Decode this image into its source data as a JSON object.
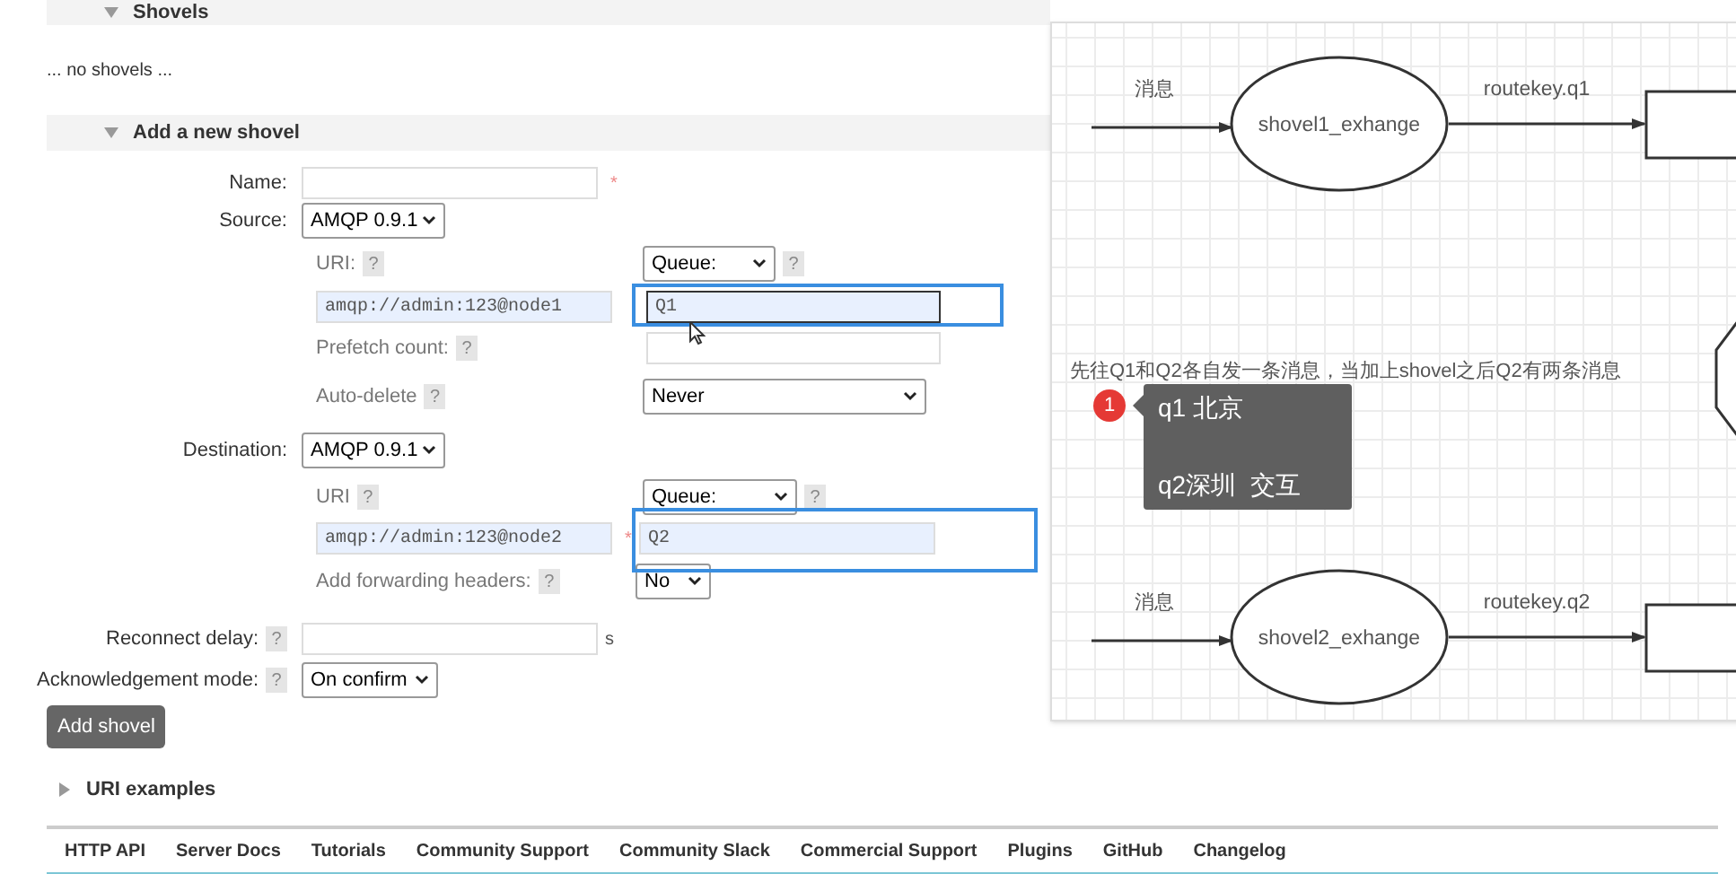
{
  "shovels_section": {
    "title": "Shovels",
    "expanded": true,
    "empty_text": "... no shovels ..."
  },
  "add_section": {
    "title": "Add a new shovel",
    "expanded": true
  },
  "form": {
    "name": {
      "label": "Name:",
      "required_mark": "*"
    },
    "source": {
      "label": "Source:",
      "protocol": "AMQP 0.9.1",
      "uri_label": "URI:",
      "uri_help": "?",
      "uri": "amqp://admin:123@node1",
      "type": "Queue:",
      "type_help": "?",
      "queue": "Q1",
      "queue_focused": true,
      "prefetch_label": "Prefetch count:",
      "prefetch_help": "?",
      "auto_delete_label": "Auto-delete",
      "auto_delete_help": "?",
      "auto_delete": "Never"
    },
    "destination": {
      "label": "Destination:",
      "protocol": "AMQP 0.9.1",
      "uri_label": "URI",
      "uri_help": "?",
      "uri": "amqp://admin:123@node2",
      "required_mark": "*",
      "type": "Queue:",
      "type_help": "?",
      "queue": "Q2",
      "queue_focused": false,
      "headers_label": "Add forwarding headers:",
      "headers_help": "?",
      "headers": "No"
    },
    "reconnect": {
      "label": "Reconnect delay:",
      "help": "?",
      "unit": "s"
    },
    "ack": {
      "label": "Acknowledgement mode:",
      "help": "?",
      "value": "On confirm"
    },
    "submit": "Add shovel"
  },
  "uri_examples": {
    "title": "URI examples",
    "expanded": false
  },
  "footer_links": [
    "HTTP API",
    "Server Docs",
    "Tutorials",
    "Community Support",
    "Community Slack",
    "Commercial Support",
    "Plugins",
    "GitHub",
    "Changelog"
  ],
  "diagram": {
    "flows": [
      {
        "input_label": "消息",
        "exchange": "shovel1_exhange",
        "route_label": "routekey.q1"
      },
      {
        "input_label": "消息",
        "exchange": "shovel2_exhange",
        "route_label": "routekey.q2"
      }
    ],
    "note": "先往Q1和Q2各自发一条消息，当加上shovel之后Q2有两条消息"
  },
  "tooltip": {
    "badge": "1",
    "lines": [
      "q1 北京",
      "q2深圳  交互"
    ]
  }
}
